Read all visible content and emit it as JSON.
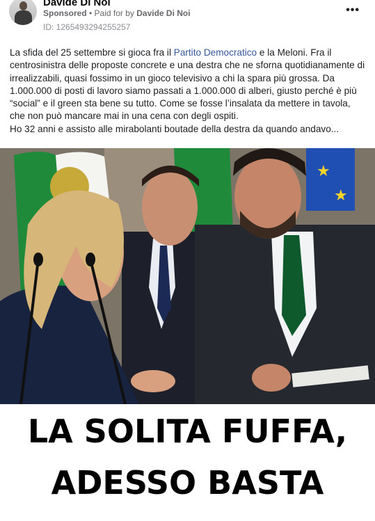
{
  "post": {
    "page_name": "Davide Di Noi",
    "sponsored_label": "Sponsored",
    "separator": " • ",
    "paid_for_label": "Paid for by ",
    "paid_for_name": "Davide Di Noi",
    "ad_id": "ID: 1265493294255257",
    "more_icon": "more-horizontal-icon",
    "text_before_link": "La sfida del 25 settembre si gioca fra il ",
    "link_text": "Partito Democratico",
    "text_after_link": " e la Meloni. Fra il centrosinistra delle proposte concrete e una destra che ne sforna quotidianamente di irrealizzabili, quasi fossimo in un gioco televisivo a chi la spara più grossa. Da 1.000.000 di posti di lavoro siamo passati a 1.000.000 di alberi, giusto perché è più “social” e il green sta bene su tutto. Come se fosse l’insalata da mettere in tavola, che non può mancare mai in una cena con degli ospiti.",
    "text_line_2": "Ho 32 anni e assisto alle mirabolanti boutade della destra da quando andavo..."
  },
  "image": {
    "banner_line_1": "LA SOLITA FUFFA,",
    "banner_line_2": "ADESSO BASTA"
  },
  "colors": {
    "link": "#385898",
    "meta_text": "#65676b",
    "banner_text": "#000000"
  }
}
